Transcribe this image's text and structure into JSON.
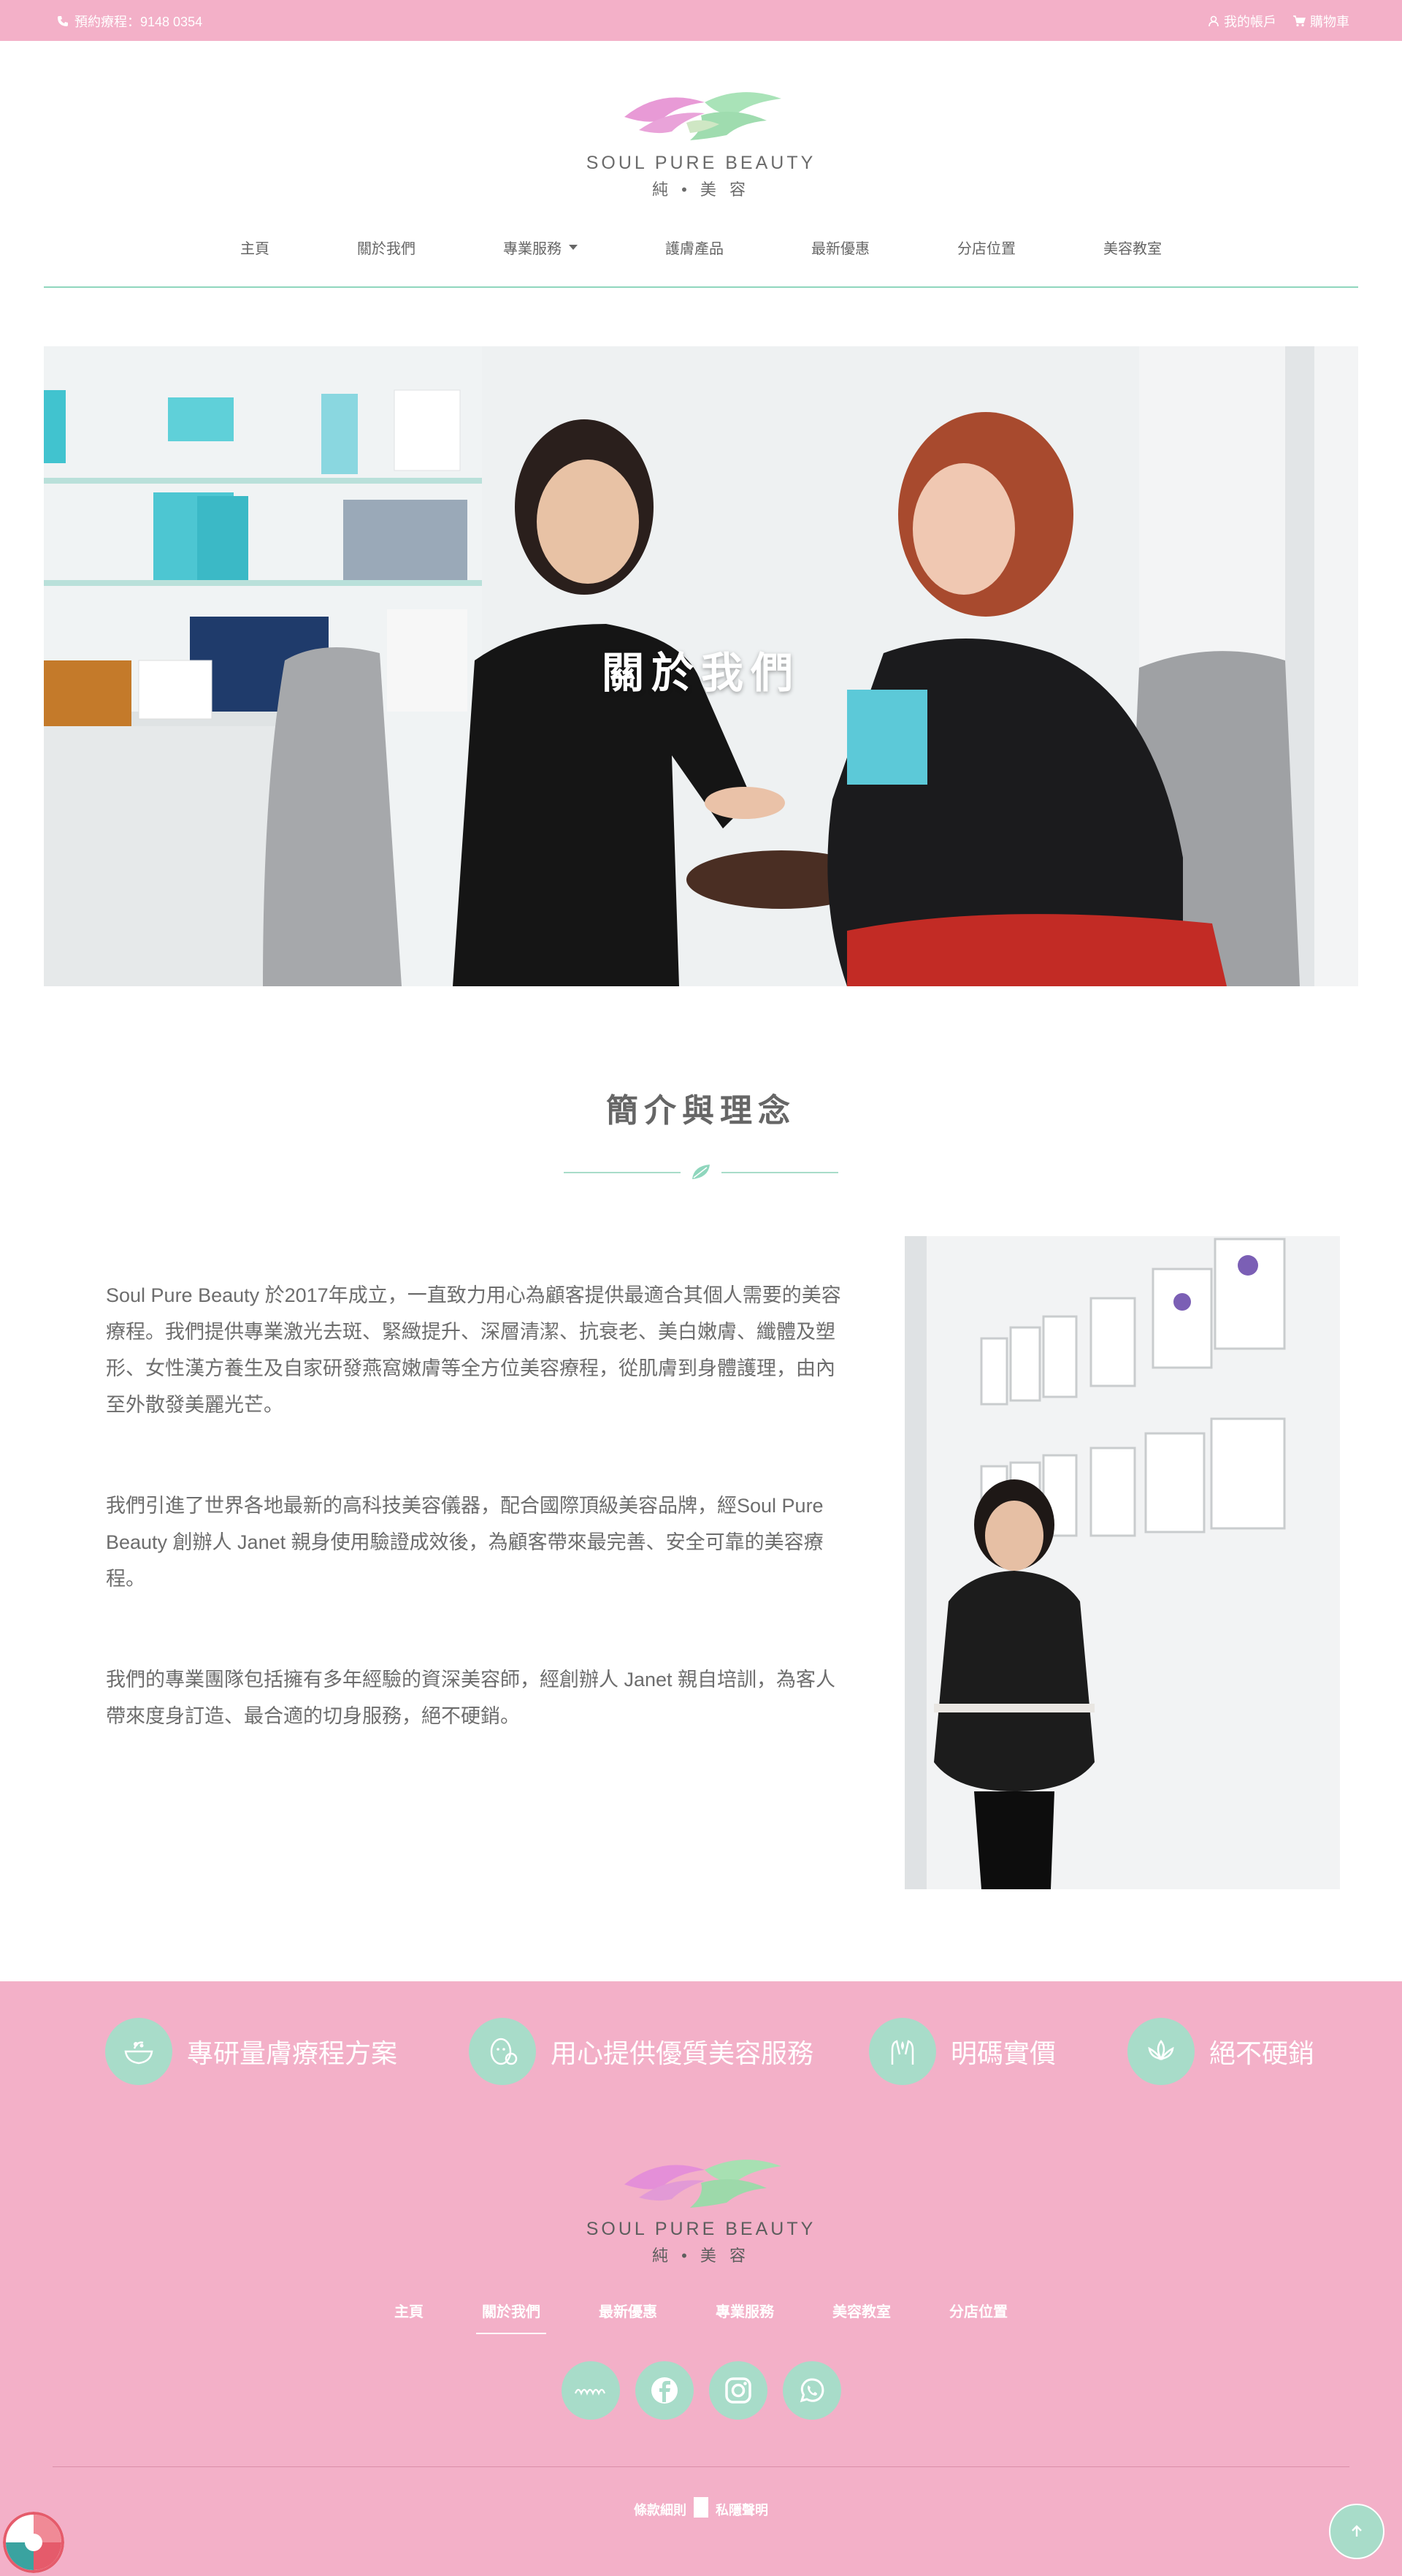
{
  "topbar": {
    "phone_text": "預約療程：9148 0354",
    "account_label": "我的帳戶",
    "cart_label": "購物車"
  },
  "brand": {
    "name_en": "SOUL PURE BEAUTY",
    "name_zh": "純 • 美 容"
  },
  "nav": {
    "items": [
      "主頁",
      "關於我們",
      "專業服務",
      "護膚產品",
      "最新優惠",
      "分店位置",
      "美容教室"
    ]
  },
  "hero": {
    "title": "關於我們"
  },
  "intro": {
    "title": "簡介與理念",
    "paragraphs": [
      "Soul Pure Beauty 於2017年成立，一直致力用心為顧客提供最適合其個人需要的美容療程。我們提供專業激光去斑、緊緻提升、深層清潔、抗衰老、美白嫩膚、纖體及塑形、女性漢方養生及自家研發燕窩嫩膚等全方位美容療程，從肌膚到身體護理，由內至外散發美麗光芒。",
      "我們引進了世界各地最新的高科技美容儀器，配合國際頂級美容品牌，經Soul Pure Beauty 創辦人 Janet 親身使用驗證成效後，為顧客帶來最完善、安全可靠的美容療程。",
      "我們的專業團隊包括擁有多年經驗的資深美容師，經創辦人 Janet 親自培訓，為客人帶來度身訂造、最合適的切身服務，絕不硬銷。"
    ]
  },
  "features": [
    {
      "label": "專研量膚療程方案",
      "icon": "bowl-icon"
    },
    {
      "label": "用心提供優質美容服務",
      "icon": "face-care-icon"
    },
    {
      "label": "明碼實價",
      "icon": "hands-icon"
    },
    {
      "label": "絕不硬銷",
      "icon": "lotus-icon"
    }
  ],
  "footer": {
    "nav": [
      "主頁",
      "關於我們",
      "最新優惠",
      "專業服務",
      "美容教室",
      "分店位置"
    ],
    "active_nav": "關於我們",
    "social": [
      "openrice-icon",
      "facebook-icon",
      "instagram-icon",
      "whatsapp-icon"
    ],
    "legal": [
      "條款細則",
      "私隱聲明"
    ]
  },
  "colors": {
    "pink": "#f3b0c8",
    "mint": "#a8dcc9",
    "nav_rule": "#8fd6bd"
  }
}
